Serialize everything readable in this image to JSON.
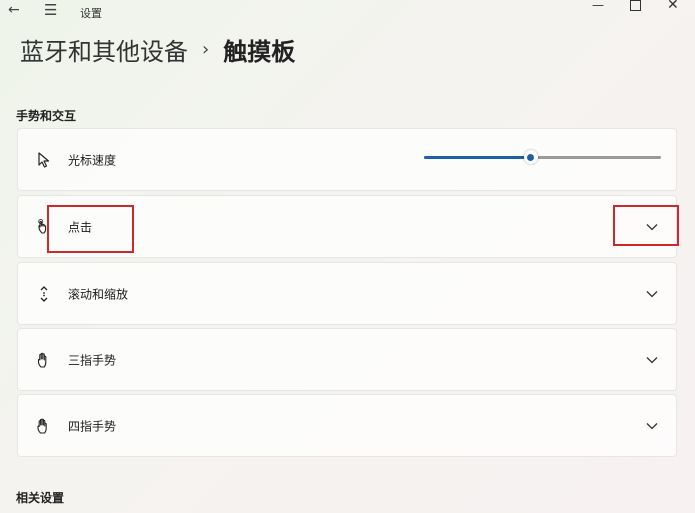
{
  "window": {
    "title": "设置"
  },
  "breadcrumb": {
    "parent": "蓝牙和其他设备",
    "separator": "›",
    "current": "触摸板"
  },
  "sections": {
    "gestures": "手势和交互",
    "related": "相关设置"
  },
  "rows": [
    {
      "label": "光标速度",
      "icon": "cursor-icon"
    },
    {
      "label": "点击",
      "icon": "tap-hand-icon"
    },
    {
      "label": "滚动和缩放",
      "icon": "scroll-icon"
    },
    {
      "label": "三指手势",
      "icon": "three-finger-hand-icon"
    },
    {
      "label": "四指手势",
      "icon": "four-finger-hand-icon"
    }
  ],
  "cursor_speed": {
    "value": 0.45
  },
  "colors": {
    "accent": "#1f5fa8",
    "highlight": "#cc2a2a"
  }
}
